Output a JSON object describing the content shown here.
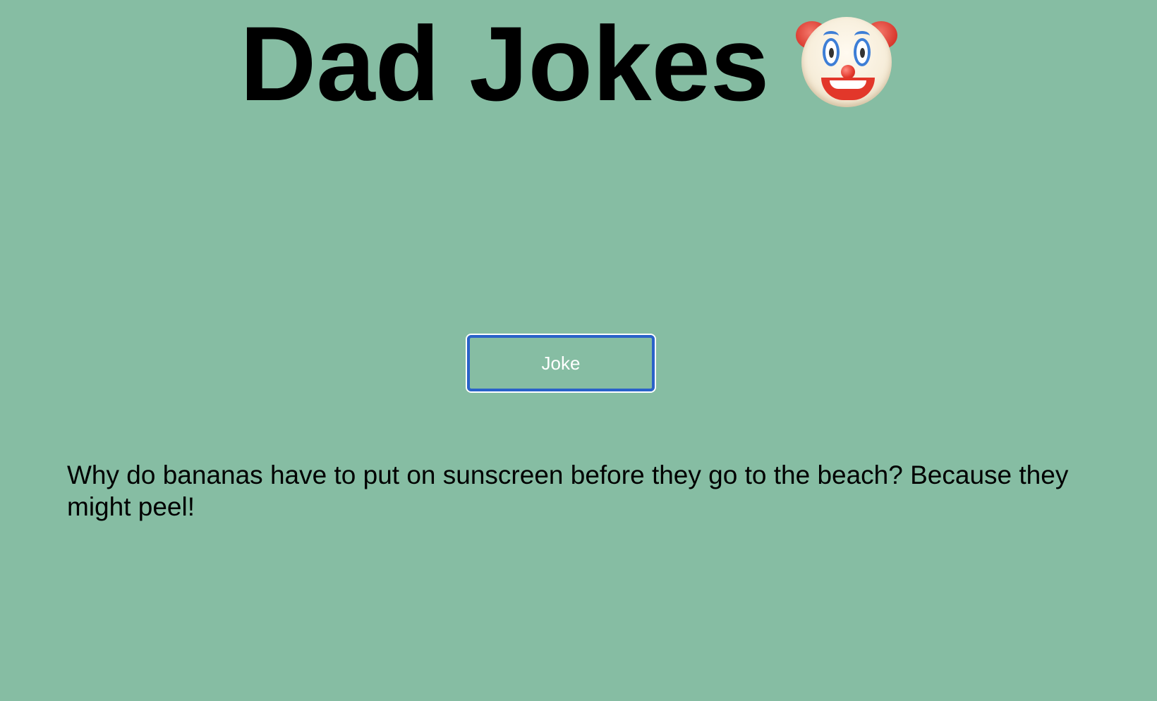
{
  "page": {
    "background_color": "#86bda3"
  },
  "header": {
    "title": "Dad Jokes",
    "emoji_icon": "clown-face-icon"
  },
  "joke_button": {
    "label": "Joke",
    "border_color": "#2a62c9",
    "text_color": "#ffffff"
  },
  "joke": {
    "text": "Why do bananas have to put on sunscreen before they go to the beach? Because they might peel!"
  }
}
